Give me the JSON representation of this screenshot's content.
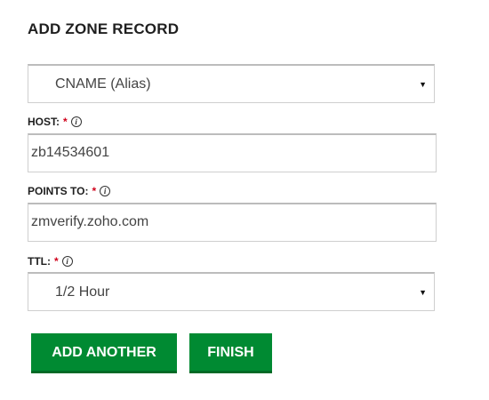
{
  "form": {
    "title": "ADD ZONE RECORD",
    "record_type": {
      "selected": "CNAME (Alias)",
      "caret": "▼"
    },
    "host": {
      "label": "HOST:",
      "required_marker": "*",
      "info_icon": "info-icon",
      "value": "zb14534601"
    },
    "points_to": {
      "label": "POINTS TO:",
      "required_marker": "*",
      "info_icon": "info-icon",
      "value": "zmverify.zoho.com"
    },
    "ttl": {
      "label": "TTL:",
      "required_marker": "*",
      "info_icon": "info-icon",
      "selected": "1/2 Hour",
      "caret": "▼"
    },
    "buttons": {
      "add_another": "ADD ANOTHER",
      "finish": "FINISH"
    }
  },
  "colors": {
    "primary_button": "#008a32",
    "required": "#d0021b"
  }
}
